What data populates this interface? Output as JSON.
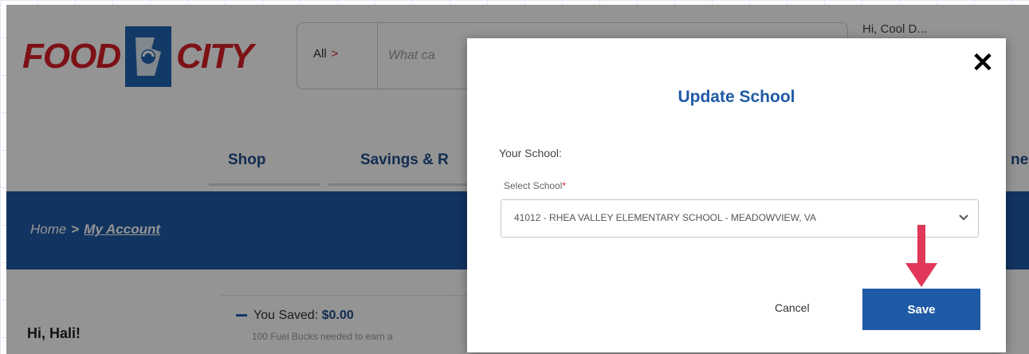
{
  "brand": {
    "logo_left": "FOOD",
    "logo_right": "CITY",
    "red": "#d71f26",
    "blue": "#1f5aa6"
  },
  "search": {
    "scope": "All",
    "scope_icon": "chevron-right-icon",
    "placeholder": "What ca"
  },
  "header": {
    "user_text": "Hi, Cool D..."
  },
  "nav": {
    "items": [
      {
        "label": "Shop"
      },
      {
        "label": "Savings & R"
      },
      {
        "label": "ne"
      }
    ]
  },
  "breadcrumb": {
    "home": "Home",
    "separator": ">",
    "current": "My Account"
  },
  "account": {
    "greeting": "Hi, Hali!",
    "saved_label": "You Saved:",
    "saved_value": "$0.00",
    "fuel_note": "100 Fuel Bucks needed to earn a"
  },
  "modal": {
    "title": "Update School",
    "close_icon": "close-icon",
    "field_heading": "Your School:",
    "field_label": "Select School",
    "required_mark": "*",
    "selected_school": "41012 - RHEA VALLEY ELEMENTARY SCHOOL - MEADOWVIEW, VA",
    "cancel_label": "Cancel",
    "save_label": "Save",
    "annotation": "arrow-down-icon",
    "annotation_color": "#e0375a"
  }
}
